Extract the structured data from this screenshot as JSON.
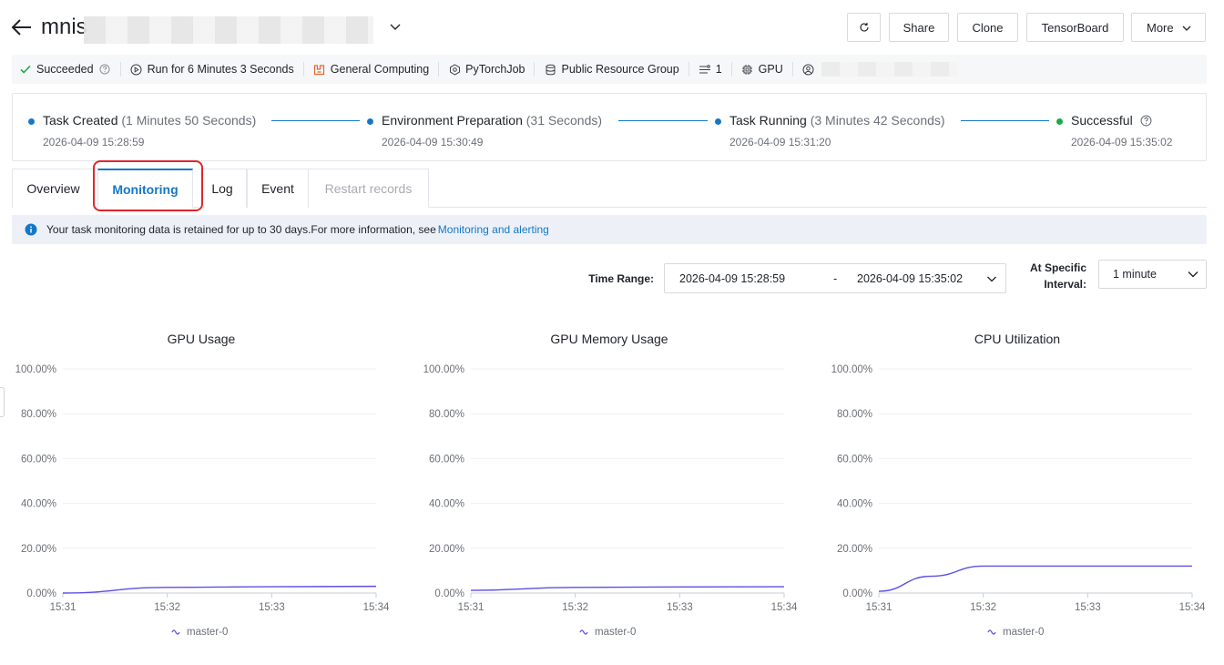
{
  "header": {
    "title": "mnis",
    "buttons": {
      "share": "Share",
      "clone": "Clone",
      "tensorboard": "TensorBoard",
      "more": "More"
    }
  },
  "info_bar": {
    "status": "Succeeded",
    "run_time": "Run for 6 Minutes 3 Seconds",
    "resource_type": "General Computing",
    "job_type": "PyTorchJob",
    "resource_group": "Public Resource Group",
    "node_count": "1",
    "device": "GPU"
  },
  "timeline": {
    "steps": [
      {
        "name": "Task Created",
        "duration": "(1 Minutes 50 Seconds)",
        "time": "2026-04-09 15:28:59"
      },
      {
        "name": "Environment Preparation",
        "duration": "(31 Seconds)",
        "time": "2026-04-09 15:30:49"
      },
      {
        "name": "Task Running",
        "duration": "(3 Minutes 42 Seconds)",
        "time": "2026-04-09 15:31:20"
      },
      {
        "name": "Successful",
        "duration": "",
        "time": "2026-04-09 15:35:02"
      }
    ],
    "colors": {
      "step": "#1677c8",
      "success": "#1aaa4a"
    }
  },
  "tabs": [
    {
      "label": "Overview",
      "state": "normal"
    },
    {
      "label": "Monitoring",
      "state": "active"
    },
    {
      "label": "Log",
      "state": "normal"
    },
    {
      "label": "Event",
      "state": "normal"
    },
    {
      "label": "Restart records",
      "state": "disabled"
    }
  ],
  "notice": {
    "text": "Your task monitoring data is retained for up to 30 days.For more information, see",
    "link": "Monitoring and alerting"
  },
  "filters": {
    "time_range_label": "Time Range:",
    "start": "2026-04-09 15:28:59",
    "separator": "-",
    "end": "2026-04-09 15:35:02",
    "interval_label_1": "At Specific",
    "interval_label_2": "Interval:",
    "interval_value": "1 minute"
  },
  "chart_data": [
    {
      "type": "line",
      "title": "GPU Usage",
      "x": [
        "15:31",
        "15:32",
        "15:33",
        "15:34"
      ],
      "xlim": [
        0,
        3
      ],
      "ylim": [
        0,
        100
      ],
      "yticks": [
        "0.00%",
        "20.00%",
        "40.00%",
        "60.00%",
        "80.00%",
        "100.00%"
      ],
      "series": [
        {
          "name": "master-0",
          "points": [
            [
              0,
              0.0
            ],
            [
              1,
              2.5
            ],
            [
              2,
              2.8
            ],
            [
              3,
              3.0
            ]
          ]
        }
      ]
    },
    {
      "type": "line",
      "title": "GPU Memory Usage",
      "x": [
        "15:31",
        "15:32",
        "15:33",
        "15:34"
      ],
      "xlim": [
        0,
        3
      ],
      "ylim": [
        0,
        100
      ],
      "yticks": [
        "0.00%",
        "20.00%",
        "40.00%",
        "60.00%",
        "80.00%",
        "100.00%"
      ],
      "series": [
        {
          "name": "master-0",
          "points": [
            [
              0,
              1.2
            ],
            [
              1,
              2.5
            ],
            [
              2,
              2.7
            ],
            [
              3,
              2.8
            ]
          ]
        }
      ]
    },
    {
      "type": "line",
      "title": "CPU Utilization",
      "x": [
        "15:31",
        "15:32",
        "15:33",
        "15:34"
      ],
      "xlim": [
        0,
        3
      ],
      "ylim": [
        0,
        100
      ],
      "yticks": [
        "0.00%",
        "20.00%",
        "40.00%",
        "60.00%",
        "80.00%",
        "100.00%"
      ],
      "series": [
        {
          "name": "master-0",
          "points": [
            [
              0,
              0.8
            ],
            [
              0.5,
              7.5
            ],
            [
              1,
              12.0
            ],
            [
              2,
              12.0
            ],
            [
              3,
              12.0
            ]
          ]
        }
      ]
    }
  ],
  "colors": {
    "accent": "#1677c8",
    "series": "#5b4fe6",
    "highlight": "#e0262b"
  }
}
